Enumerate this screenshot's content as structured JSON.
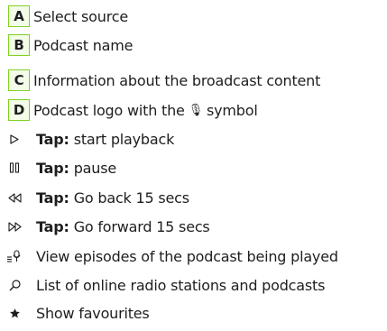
{
  "colors": {
    "badge_border": "#7ed321",
    "badge_fill": "#f3fbe9",
    "text": "#1e1e1e"
  },
  "lettered_items": [
    {
      "letter": "A",
      "text": "Select source"
    },
    {
      "letter": "B",
      "text": "Podcast name"
    },
    {
      "letter": "C",
      "text": "Information about the broadcast content"
    },
    {
      "letter": "D",
      "text": "Podcast logo with the",
      "symbol": "🎙",
      "symbol_text": "symbol"
    }
  ],
  "icon_items": [
    {
      "icon": "play-icon",
      "bold": "Tap:",
      "text": "start playback"
    },
    {
      "icon": "pause-icon",
      "bold": "Tap:",
      "text": "pause"
    },
    {
      "icon": "rewind-icon",
      "bold": "Tap:",
      "text": "Go back 15 secs"
    },
    {
      "icon": "fast-forward-icon",
      "bold": "Tap:",
      "text": "Go forward 15 secs"
    },
    {
      "icon": "episode-list-icon",
      "text": "View episodes of the podcast being played"
    },
    {
      "icon": "search-icon",
      "text": "List of online radio stations and podcasts"
    },
    {
      "icon": "star-icon",
      "text": "Show favourites"
    }
  ]
}
